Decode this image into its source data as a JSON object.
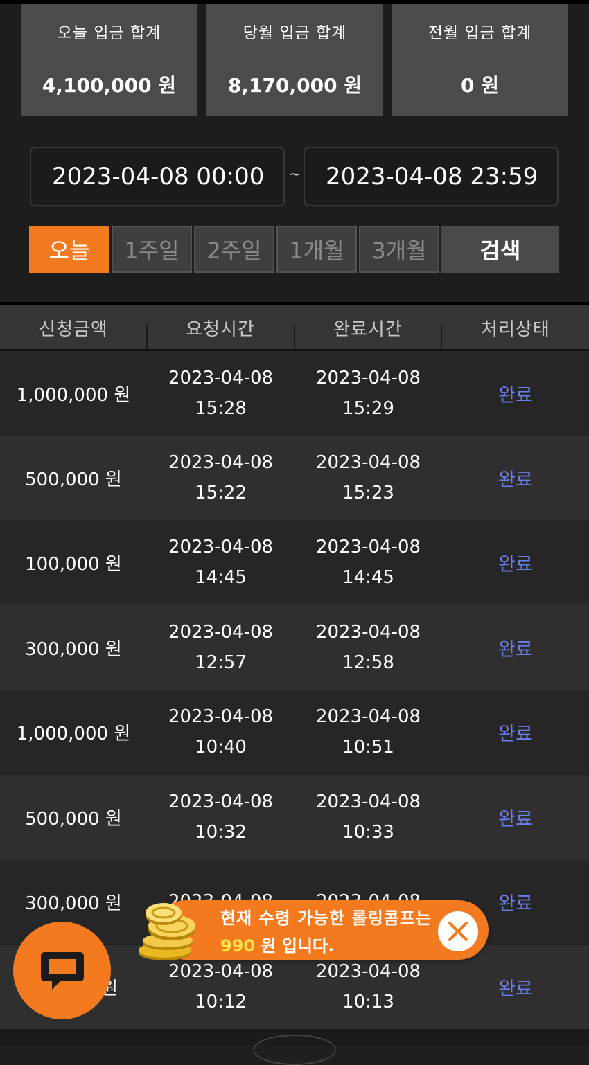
{
  "summary": [
    {
      "label": "오늘 입금 합계",
      "value": "4,100,000 원"
    },
    {
      "label": "당월 입금 합계",
      "value": "8,170,000 원"
    },
    {
      "label": "전월 입금 합계",
      "value": "0 원"
    }
  ],
  "date_range": {
    "start": "2023-04-08 00:00",
    "end": "2023-04-08 23:59",
    "separator": "~"
  },
  "period_buttons": [
    "오늘",
    "1주일",
    "2주일",
    "1개월",
    "3개월"
  ],
  "search_label": "검색",
  "table": {
    "headers": [
      "신청금액",
      "요청시간",
      "완료시간",
      "처리상태"
    ],
    "rows": [
      {
        "amount": "1,000,000 원",
        "req_date": "2023-04-08",
        "req_time": "15:28",
        "done_date": "2023-04-08",
        "done_time": "15:29",
        "status": "완료"
      },
      {
        "amount": "500,000 원",
        "req_date": "2023-04-08",
        "req_time": "15:22",
        "done_date": "2023-04-08",
        "done_time": "15:23",
        "status": "완료"
      },
      {
        "amount": "100,000 원",
        "req_date": "2023-04-08",
        "req_time": "14:45",
        "done_date": "2023-04-08",
        "done_time": "14:45",
        "status": "완료"
      },
      {
        "amount": "300,000 원",
        "req_date": "2023-04-08",
        "req_time": "12:57",
        "done_date": "2023-04-08",
        "done_time": "12:58",
        "status": "완료"
      },
      {
        "amount": "1,000,000 원",
        "req_date": "2023-04-08",
        "req_time": "10:40",
        "done_date": "2023-04-08",
        "done_time": "10:51",
        "status": "완료"
      },
      {
        "amount": "500,000 원",
        "req_date": "2023-04-08",
        "req_time": "10:32",
        "done_date": "2023-04-08",
        "done_time": "10:33",
        "status": "완료"
      },
      {
        "amount": "300,000 원",
        "req_date": "2023-04-08",
        "req_time": "",
        "done_date": "2023-04-08",
        "done_time": "",
        "status": "완료"
      },
      {
        "amount": "원",
        "req_date": "2023-04-08",
        "req_time": "10:12",
        "done_date": "2023-04-08",
        "done_time": "10:13",
        "status": "완료"
      }
    ]
  },
  "notice": {
    "line1": "현재 수령 가능한 롤링콤프는",
    "amount": "990",
    "line2_suffix": " 원 입니다."
  },
  "colors": {
    "accent": "#f47a20",
    "status": "#6a7ff0",
    "highlight": "#ffe14a"
  },
  "icons": {
    "chat": "chat-bubble-icon",
    "close": "close-icon",
    "coins": "gold-coins-icon"
  }
}
